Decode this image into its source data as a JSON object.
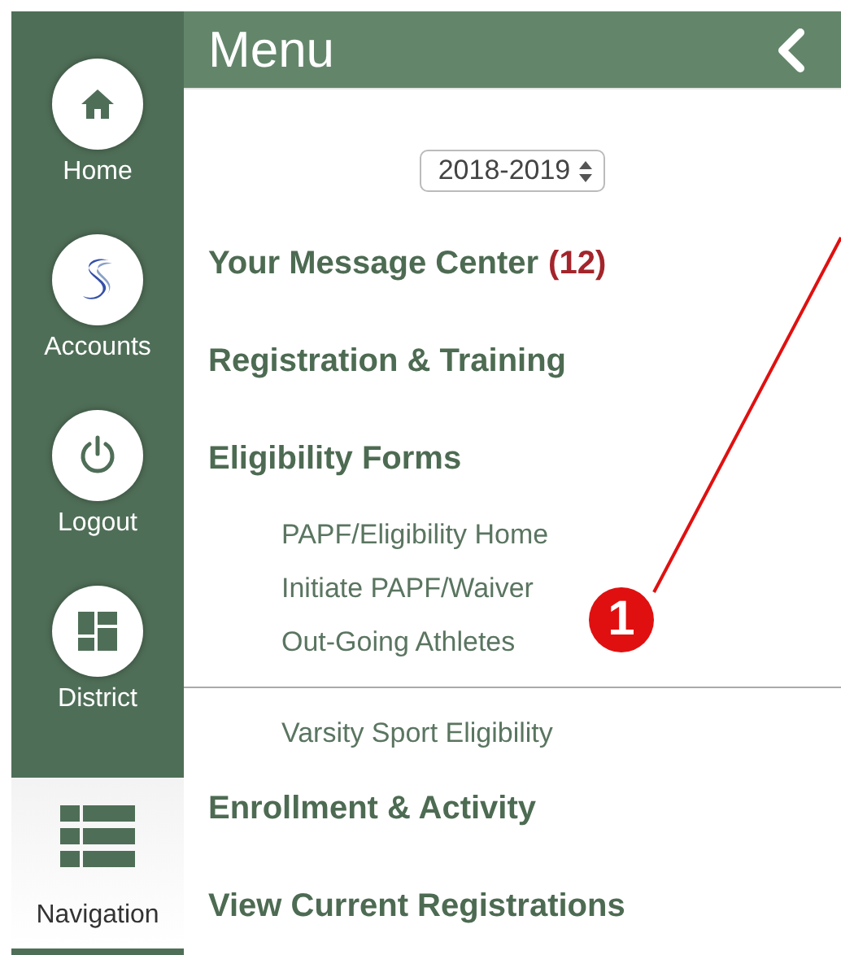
{
  "sidebar": {
    "items": [
      {
        "kind": "home",
        "label": "Home",
        "selected": false
      },
      {
        "kind": "accounts",
        "label": "Accounts",
        "selected": false
      },
      {
        "kind": "logout",
        "label": "Logout",
        "selected": false
      },
      {
        "kind": "district",
        "label": "District",
        "selected": false
      },
      {
        "kind": "navigation",
        "label": "Navigation",
        "selected": true
      }
    ]
  },
  "menu": {
    "title": "Menu",
    "year_select": {
      "value": "2018-2019"
    },
    "items": [
      {
        "kind": "heading",
        "label": "Your Message Center",
        "count": "(12)"
      },
      {
        "kind": "heading",
        "label": "Registration & Training"
      },
      {
        "kind": "heading",
        "label": "Eligibility Forms"
      },
      {
        "kind": "link",
        "label": "PAPF/Eligibility Home"
      },
      {
        "kind": "link",
        "label": "Initiate PAPF/Waiver"
      },
      {
        "kind": "link",
        "label": "Out-Going Athletes"
      },
      {
        "kind": "divider"
      },
      {
        "kind": "link",
        "label": "Varsity Sport Eligibility"
      },
      {
        "kind": "heading",
        "label": "Enrollment & Activity"
      },
      {
        "kind": "heading",
        "label": "View Current Registrations"
      }
    ]
  },
  "callout": {
    "number": "1"
  }
}
